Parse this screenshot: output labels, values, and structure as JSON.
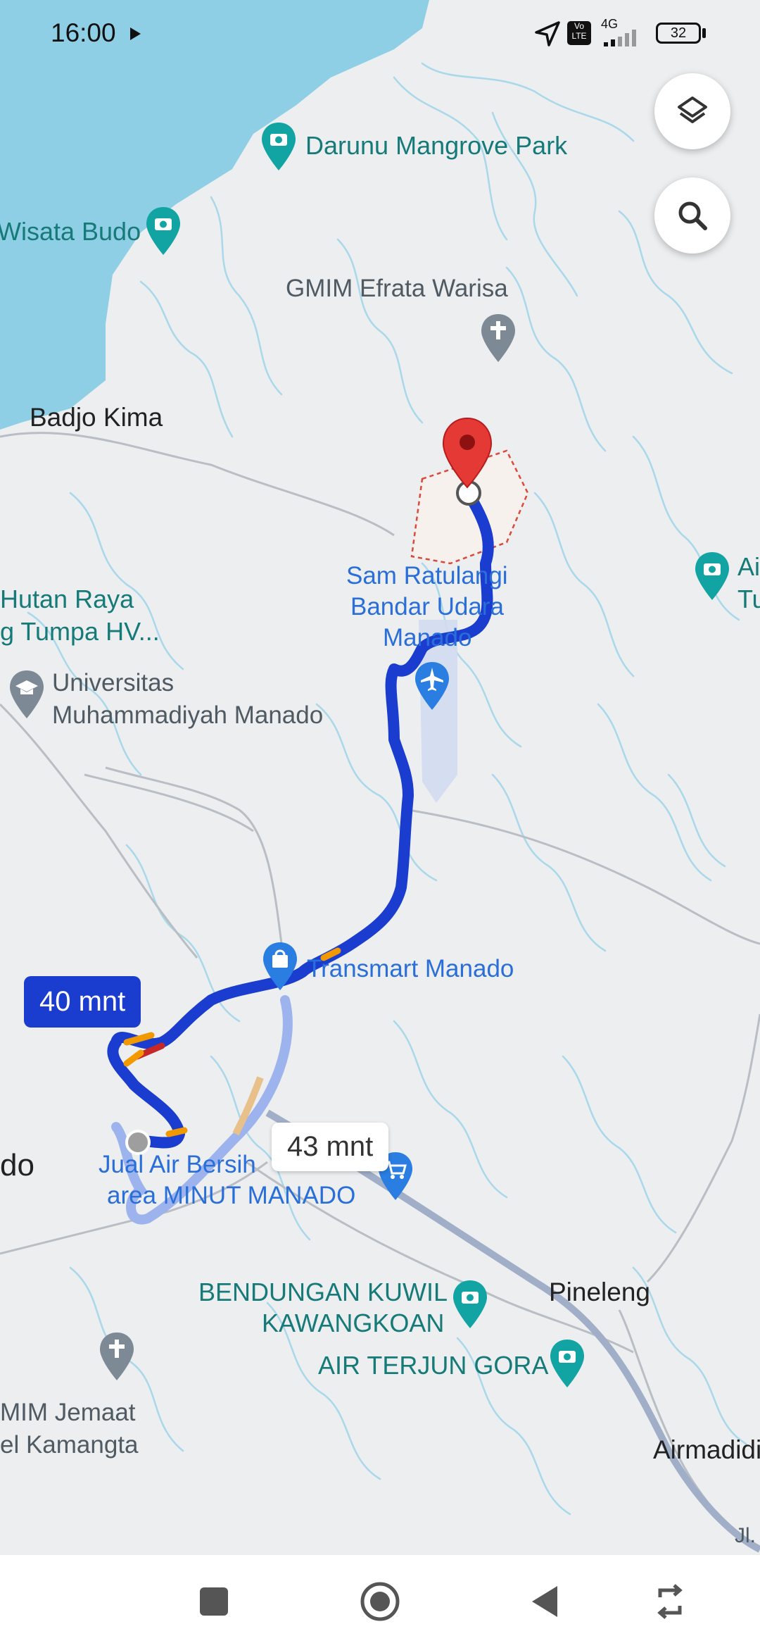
{
  "status_bar": {
    "time": "16:00",
    "network": "4G",
    "volte": "Vo LTE",
    "battery": "32",
    "icons": [
      "play-icon",
      "location-arrow-icon",
      "volte-icon",
      "signal-icon",
      "battery-icon"
    ]
  },
  "map": {
    "colors": {
      "water": "#8fcfe6",
      "land": "#eceef0",
      "route": "#1a3ccf",
      "route_alt": "#9cb3ee",
      "traffic": "#f29900",
      "destination_pin": "#e53935"
    },
    "labels": {
      "darunu": "Darunu Mangrove Park",
      "wisata_budo": "Wisata Budo",
      "gmim_efrata": "GMIM Efrata Warisa",
      "badjo_kima": "Badjo Kima",
      "hutan_raya_1": "Hutan Raya",
      "hutan_raya_2": "g Tumpa HV...",
      "universitas_1": "Universitas",
      "universitas_2": "Muhammadiyah Manado",
      "airport_1": "Sam Ratulangi",
      "airport_2": "Bandar Udara",
      "airport_3": "Manado",
      "right_edge_1": "Ai",
      "right_edge_2": "Tu",
      "transmart": "Transmart Manado",
      "manado_edge": "do",
      "jual_air_1": "Jual Air Bersih",
      "jual_air_2": "area MINUT MANADO",
      "bendungan_1": "BENDUNGAN KUWIL",
      "bendungan_2": "KAWANGKOAN",
      "pineleng": "Pineleng",
      "air_terjun": "AIR TERJUN GORA",
      "gmim_jemaat_1": "MIM Jemaat",
      "gmim_jemaat_2": "el Kamangta",
      "airmadidi": "Airmadidi",
      "road_edge": "Jl."
    },
    "route_primary_time": "40 mnt",
    "route_alternative_time": "43 mnt"
  },
  "controls": {
    "layers_icon": "layers-icon",
    "search_icon": "search-icon"
  },
  "nav_bar": {
    "buttons": [
      "square-icon",
      "home-circle-icon",
      "back-triangle-icon",
      "rotate-icon"
    ]
  }
}
